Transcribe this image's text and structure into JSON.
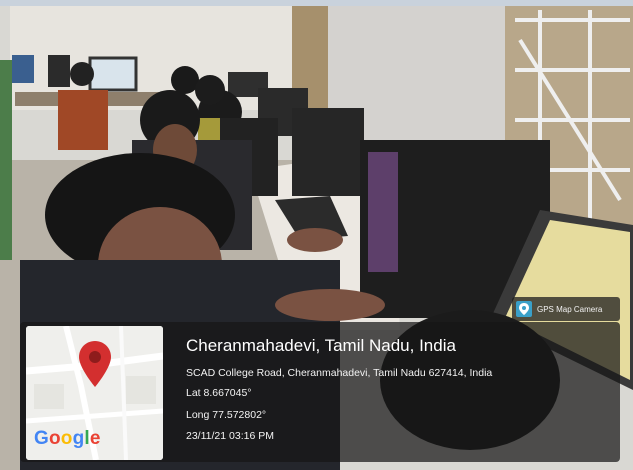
{
  "location": {
    "title": "Cheranmahadevi, Tamil Nadu, India",
    "address": "SCAD College Road, Cheranmahadevi, Tamil Nadu 627414, India",
    "lat": "Lat 8.667045°",
    "long": "Long 77.572802°",
    "datetime": "23/11/21 03:16 PM"
  },
  "badge": {
    "label": "GPS Map Camera",
    "icon": "camera-pin-icon"
  },
  "map": {
    "brand_letters": [
      "G",
      "o",
      "o",
      "g",
      "l",
      "e"
    ],
    "pin_icon": "map-pin-icon"
  },
  "colors": {
    "pin": "#d32f2f",
    "overlay": "#161616"
  }
}
